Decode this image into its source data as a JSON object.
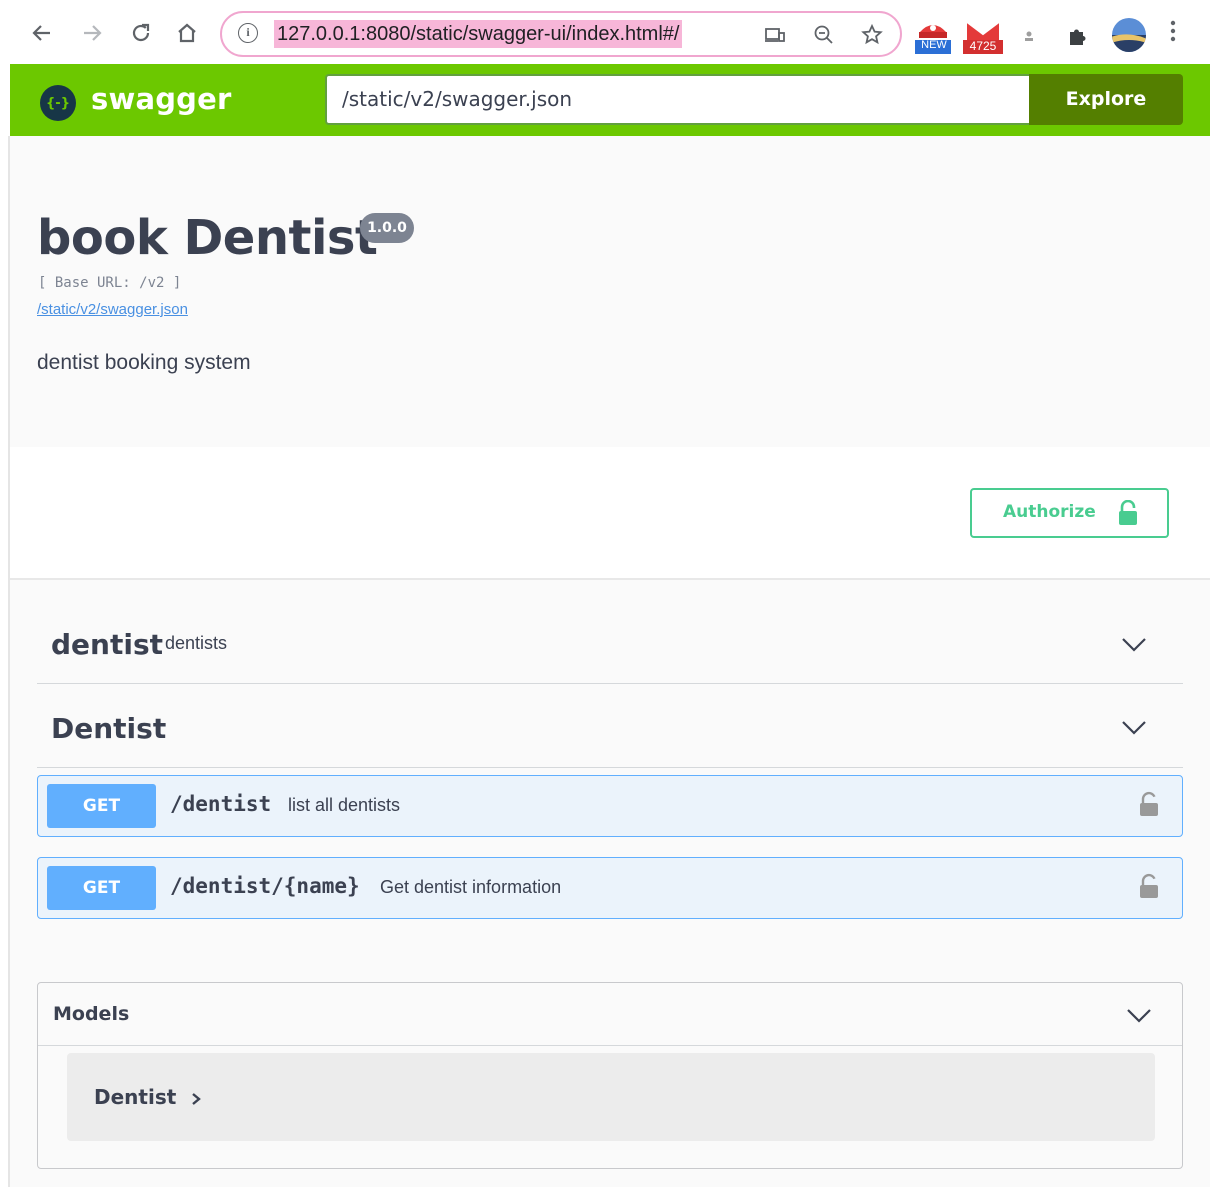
{
  "browser": {
    "url": "127.0.0.1:8080/static/swagger-ui/index.html#/",
    "extension_badges": [
      "NEW",
      "4725"
    ]
  },
  "topbar": {
    "logo_text": "swagger",
    "logo_symbol": "{-}",
    "spec_url": "/static/v2/swagger.json",
    "explore_label": "Explore"
  },
  "info": {
    "title": "book Dentist",
    "version": "1.0.0",
    "base_url": "[ Base URL: /v2 ]",
    "spec_link": "/static/v2/swagger.json",
    "description": "dentist booking system"
  },
  "authorize": {
    "label": "Authorize"
  },
  "tags": [
    {
      "name": "dentist",
      "description": "dentists"
    },
    {
      "name": "Dentist",
      "description": ""
    }
  ],
  "operations": [
    {
      "method": "GET",
      "path": "/dentist",
      "summary": "list all dentists"
    },
    {
      "method": "GET",
      "path": "/dentist/{name}",
      "summary": "Get dentist information"
    }
  ],
  "models": {
    "title": "Models",
    "items": [
      {
        "name": "Dentist"
      }
    ]
  },
  "colors": {
    "topbar": "#6cc800",
    "explore": "#547f00",
    "get_method": "#61affe",
    "get_bg": "#ebf3fb",
    "authorize": "#49cc90",
    "url_highlight": "#f7b6d8"
  }
}
